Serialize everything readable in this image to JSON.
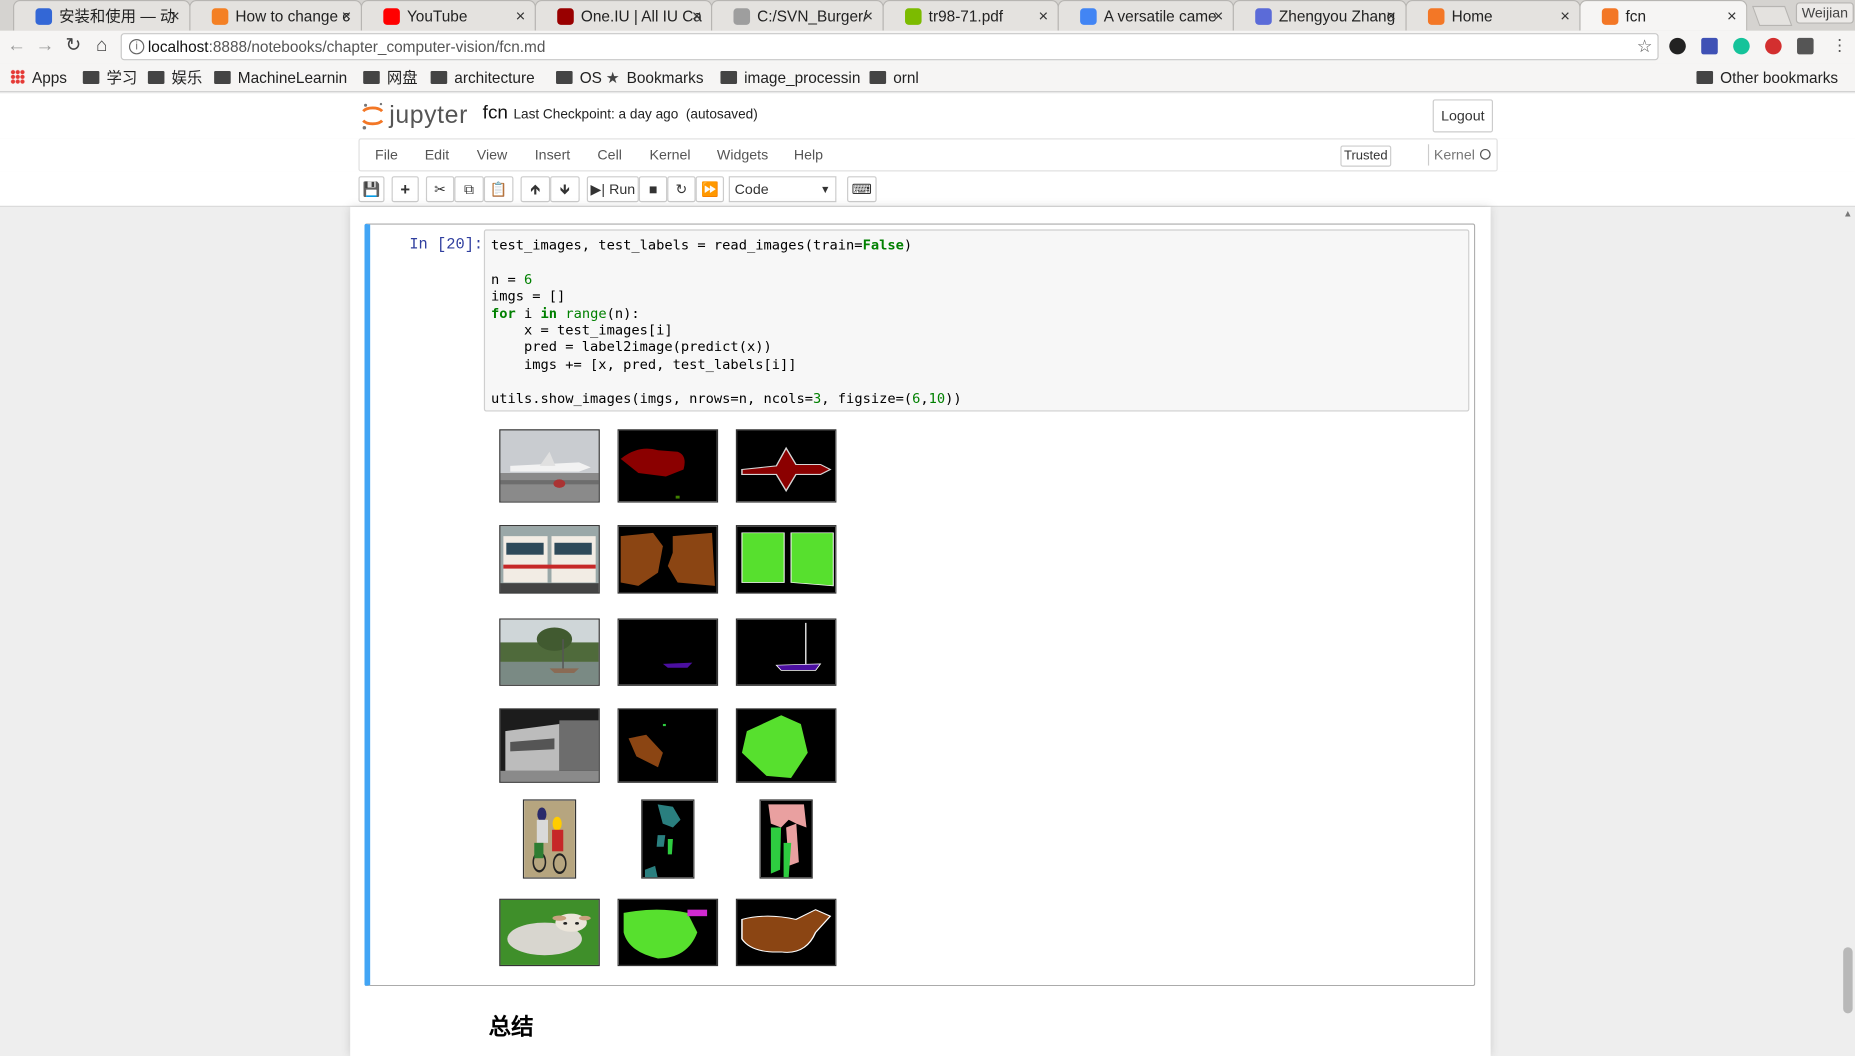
{
  "browser": {
    "tabs": [
      {
        "title": "安装和使用 — 动",
        "color": "#3367d6"
      },
      {
        "title": "How to change c",
        "color": "#f48024"
      },
      {
        "title": "YouTube",
        "color": "#ff0000"
      },
      {
        "title": "One.IU | All IU Ca",
        "color": "#990000"
      },
      {
        "title": "C:/SVN_Burger/",
        "color": "#9e9e9e"
      },
      {
        "title": "tr98-71.pdf",
        "color": "#7cbb00"
      },
      {
        "title": "A versatile came",
        "color": "#4285f4"
      },
      {
        "title": "Zhengyou Zhang",
        "color": "#5b6bd8"
      },
      {
        "title": "Home",
        "color": "#f37726"
      },
      {
        "title": "fcn",
        "color": "#f37726"
      }
    ],
    "profile_name": "Weijian",
    "url_host": "localhost",
    "url_rest": ":8888/notebooks/chapter_computer-vision/fcn.md",
    "bookmarks": [
      {
        "label": "Apps",
        "icon": "apps-icon"
      },
      {
        "label": "学习",
        "icon": "folder-icon"
      },
      {
        "label": "娱乐",
        "icon": "folder-icon"
      },
      {
        "label": "MachineLearnin",
        "icon": "folder-icon"
      },
      {
        "label": "网盘",
        "icon": "folder-icon"
      },
      {
        "label": "architecture",
        "icon": "folder-icon"
      },
      {
        "label": "OS",
        "icon": "folder-icon"
      },
      {
        "label": "Bookmarks",
        "icon": "star-icon"
      },
      {
        "label": "image_processin",
        "icon": "folder-icon"
      },
      {
        "label": "ornl",
        "icon": "folder-icon"
      }
    ],
    "other_bookmarks": "Other bookmarks"
  },
  "jupyter": {
    "logo_text": "jupyter",
    "notebook_name": "fcn",
    "checkpoint": "Last Checkpoint: a day ago",
    "autosaved": "(autosaved)",
    "logout": "Logout",
    "menu": [
      "File",
      "Edit",
      "View",
      "Insert",
      "Cell",
      "Kernel",
      "Widgets",
      "Help"
    ],
    "trusted": "Trusted",
    "kernel_label": "Kernel",
    "run_label": "Run",
    "cell_type": "Code"
  },
  "cell": {
    "prompt": "In [20]:"
  },
  "output_images": [
    {
      "row": 0,
      "kind": "photo",
      "scene": "airplane"
    },
    {
      "row": 0,
      "kind": "pred",
      "scene": "airplane"
    },
    {
      "row": 0,
      "kind": "label",
      "scene": "airplane"
    },
    {
      "row": 1,
      "kind": "photo",
      "scene": "train"
    },
    {
      "row": 1,
      "kind": "pred",
      "scene": "train"
    },
    {
      "row": 1,
      "kind": "label",
      "scene": "train"
    },
    {
      "row": 2,
      "kind": "photo",
      "scene": "boat"
    },
    {
      "row": 2,
      "kind": "pred",
      "scene": "boat"
    },
    {
      "row": 2,
      "kind": "label",
      "scene": "boat"
    },
    {
      "row": 3,
      "kind": "photo",
      "scene": "locomotive"
    },
    {
      "row": 3,
      "kind": "pred",
      "scene": "locomotive"
    },
    {
      "row": 3,
      "kind": "label",
      "scene": "locomotive"
    },
    {
      "row": 4,
      "kind": "photo",
      "scene": "cyclists"
    },
    {
      "row": 4,
      "kind": "pred",
      "scene": "cyclists"
    },
    {
      "row": 4,
      "kind": "label",
      "scene": "cyclists"
    },
    {
      "row": 5,
      "kind": "photo",
      "scene": "sheep"
    },
    {
      "row": 5,
      "kind": "pred",
      "scene": "sheep"
    },
    {
      "row": 5,
      "kind": "label",
      "scene": "sheep"
    }
  ],
  "markdown": {
    "heading": "总结"
  }
}
